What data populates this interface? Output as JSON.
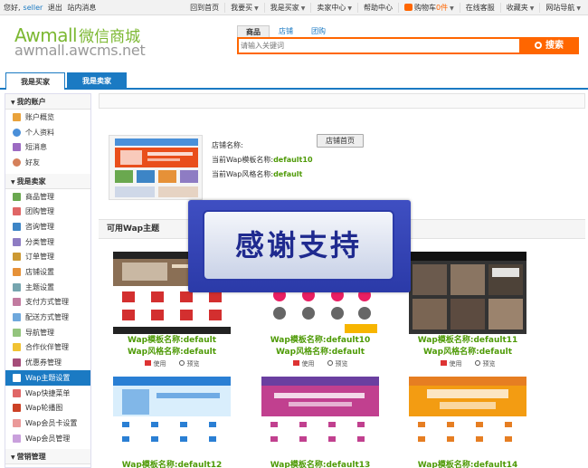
{
  "topbar": {
    "greeting": "您好,",
    "username": "seller",
    "logout": "退出",
    "messages": "站内消息",
    "links": [
      {
        "label": "回到首页",
        "caret": false
      },
      {
        "label": "我要买",
        "caret": true
      },
      {
        "label": "我是买家",
        "caret": true
      },
      {
        "label": "卖家中心",
        "caret": true
      },
      {
        "label": "帮助中心",
        "caret": false
      },
      {
        "label": "在线客服",
        "caret": false
      },
      {
        "label": "收藏夹",
        "caret": true
      },
      {
        "label": "网站导航",
        "caret": true
      }
    ],
    "cart": {
      "label": "购物车",
      "count": "0",
      "unit": "件"
    }
  },
  "header": {
    "logo_en": "Awmall",
    "logo_cn": "微信商城",
    "logo_url": "awmall.awcms.net"
  },
  "search": {
    "tabs": [
      "商品",
      "店铺",
      "团购"
    ],
    "placeholder": "请输入关键词",
    "button": "搜索"
  },
  "role_tabs": {
    "buyer": "我是买家",
    "seller": "我是卖家"
  },
  "sidebar": {
    "account_title": "我的账户",
    "account_items": [
      {
        "label": "账户概览",
        "icon": "house-icon"
      },
      {
        "label": "个人资料",
        "icon": "person-icon"
      },
      {
        "label": "短消息",
        "icon": "message-icon"
      },
      {
        "label": "好友",
        "icon": "friends-icon"
      }
    ],
    "seller_title": "我是卖家",
    "seller_items": [
      {
        "label": "商品管理",
        "icon": "goods-icon"
      },
      {
        "label": "团购管理",
        "icon": "group-buy-icon"
      },
      {
        "label": "咨询管理",
        "icon": "consult-icon"
      },
      {
        "label": "分类管理",
        "icon": "category-icon"
      },
      {
        "label": "订单管理",
        "icon": "order-icon"
      },
      {
        "label": "店铺设置",
        "icon": "shop-icon"
      },
      {
        "label": "主题设置",
        "icon": "theme-icon"
      },
      {
        "label": "支付方式管理",
        "icon": "payment-icon"
      },
      {
        "label": "配送方式管理",
        "icon": "shipping-icon"
      },
      {
        "label": "导航管理",
        "icon": "navigation-icon"
      },
      {
        "label": "合作伙伴管理",
        "icon": "partner-icon"
      },
      {
        "label": "优惠券管理",
        "icon": "coupon-icon"
      },
      {
        "label": "Wap主题设置",
        "icon": "wap-theme-icon",
        "active": true
      },
      {
        "label": "Wap快捷菜单",
        "icon": "wap-menu-icon"
      },
      {
        "label": "Wap轮播图",
        "icon": "wap-slide-icon"
      },
      {
        "label": "Wap会员卡设置",
        "icon": "wap-card-icon"
      },
      {
        "label": "Wap会员管理",
        "icon": "wap-member-icon"
      }
    ],
    "next_title": "营销管理"
  },
  "shop": {
    "name_label": "店铺名称:",
    "home_button": "店铺首页",
    "template_label": "当前Wap模板名称:",
    "template_value": "default10",
    "style_label": "当前Wap风格名称:",
    "style_value": "default"
  },
  "wap_section_title": "可用Wap主题",
  "themes": [
    {
      "template_label": "Wap模板名称:",
      "template": "default",
      "style_label": "Wap风格名称:",
      "style": "default",
      "use": "使用",
      "preview": "预览"
    },
    {
      "template_label": "Wap模板名称:",
      "template": "default10",
      "style_label": "Wap风格名称:",
      "style": "default",
      "use": "使用",
      "preview": "预览"
    },
    {
      "template_label": "Wap模板名称:",
      "template": "default11",
      "style_label": "Wap风格名称:",
      "style": "default",
      "use": "使用",
      "preview": "预览"
    },
    {
      "template_label": "Wap模板名称:",
      "template": "default12",
      "style_label": "",
      "style": "",
      "use": "",
      "preview": ""
    },
    {
      "template_label": "Wap模板名称:",
      "template": "default13",
      "style_label": "",
      "style": "",
      "use": "",
      "preview": ""
    },
    {
      "template_label": "Wap模板名称:",
      "template": "default14",
      "style_label": "",
      "style": "",
      "use": "",
      "preview": ""
    }
  ],
  "overlay_text": "感谢支持",
  "colors": {
    "accent": "#1b7ac3",
    "search": "#ff6600",
    "logo": "#7cb832",
    "value": "#4e9a06"
  }
}
